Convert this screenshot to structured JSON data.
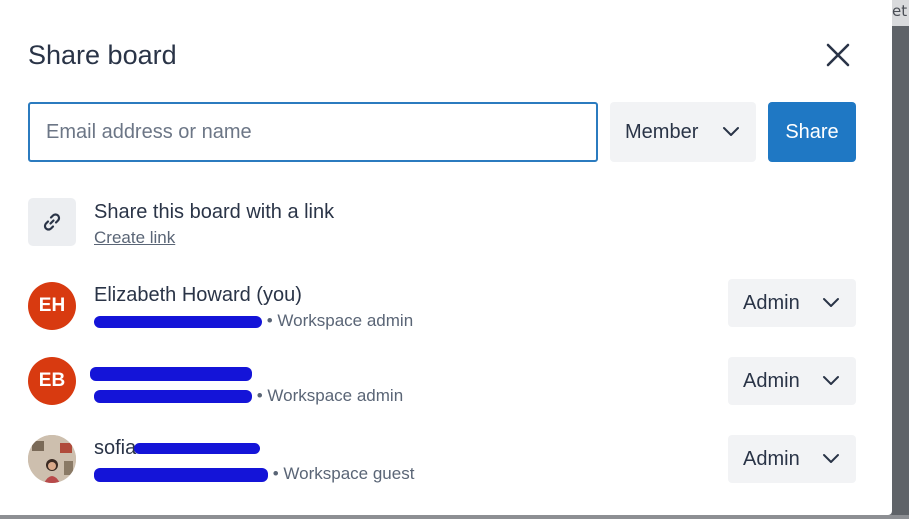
{
  "backdrop": {
    "edge_text": "et"
  },
  "dialog": {
    "title": "Share board",
    "close_icon": "close-icon",
    "email_input": {
      "value": "",
      "placeholder": "Email address or name"
    },
    "role_select": {
      "selected": "Member"
    },
    "share_button": "Share",
    "share_link": {
      "title": "Share this board with a link",
      "action": "Create link",
      "icon": "link-icon"
    },
    "members": [
      {
        "initials": "EH",
        "name": "Elizabeth Howard (you)",
        "role_text": "• Workspace admin",
        "role": "Admin",
        "avatar_color": "#d83a10"
      },
      {
        "initials": "EB",
        "name": "",
        "role_text": "• Workspace admin",
        "role": "Admin",
        "avatar_color": "#d83a10"
      },
      {
        "initials": "",
        "name": "sofia",
        "role_text": "• Workspace guest",
        "role": "Admin",
        "avatar_color": "#c9b9a5"
      }
    ]
  },
  "colors": {
    "primary": "#1f78c4",
    "input_border": "#2b7bbf",
    "redaction": "#1414d8",
    "text": "#2a3447",
    "subtext": "#5a6576"
  }
}
